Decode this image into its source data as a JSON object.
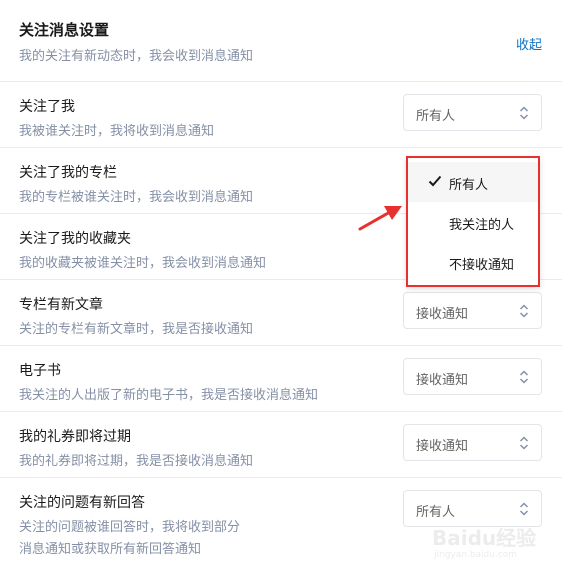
{
  "header": {
    "title": "关注消息设置",
    "desc": "我的关注有新动态时，我会收到消息通知",
    "collapse_label": "收起"
  },
  "rows": [
    {
      "title": "关注了我",
      "desc": "我被谁关注时，我将收到消息通知",
      "select_value": "所有人"
    },
    {
      "title": "关注了我的专栏",
      "desc": "我的专栏被谁关注时，我会收到消息通知",
      "select_value": ""
    },
    {
      "title": "关注了我的收藏夹",
      "desc": "我的收藏夹被谁关注时，我会收到消息通知",
      "select_value": ""
    },
    {
      "title": "专栏有新文章",
      "desc": "关注的专栏有新文章时，我是否接收通知",
      "select_value": "接收通知"
    },
    {
      "title": "电子书",
      "desc": "我关注的人出版了新的电子书，我是否接收消息通知",
      "select_value": "接收通知"
    },
    {
      "title": "我的礼券即将过期",
      "desc": "我的礼券即将过期，我是否接收消息通知",
      "select_value": "接收通知"
    },
    {
      "title": "关注的问题有新回答",
      "desc_line1": "关注的问题被谁回答时，我将收到部分",
      "desc_line2": "消息通知或获取所有新回答通知",
      "select_value": "所有人"
    }
  ],
  "dropdown": {
    "options": [
      {
        "label": "所有人",
        "selected": true
      },
      {
        "label": "我关注的人",
        "selected": false
      },
      {
        "label": "不接收通知",
        "selected": false
      }
    ],
    "highlight_color": "#e8312f"
  },
  "watermark": {
    "text": "Baidu经验",
    "sub": "jingyan.baidu.com"
  },
  "colors": {
    "link": "#0f72c4",
    "muted": "#8590a6",
    "annotation": "#e8312f"
  }
}
